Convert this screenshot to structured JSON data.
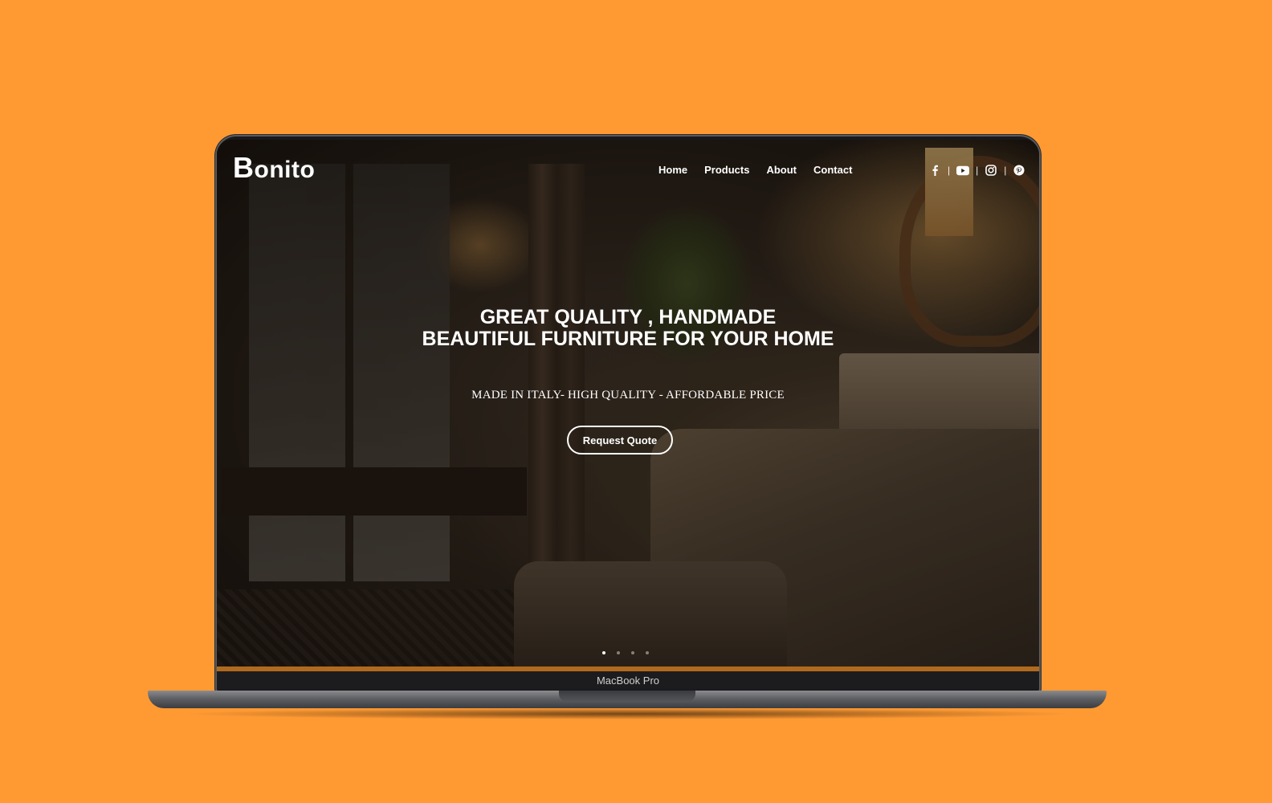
{
  "site": {
    "logo_initial": "B",
    "logo_rest": "onito"
  },
  "nav": {
    "items": [
      {
        "label": "Home"
      },
      {
        "label": "Products"
      },
      {
        "label": "About"
      },
      {
        "label": "Contact"
      }
    ]
  },
  "social": {
    "icons": [
      "facebook-icon",
      "youtube-icon",
      "instagram-icon",
      "pinterest-icon"
    ],
    "separator": "|"
  },
  "hero": {
    "title_line1": "GREAT QUALITY , HANDMADE",
    "title_line2": "BEAUTIFUL FURNITURE FOR YOUR HOME",
    "subtitle": "MADE IN ITALY- HIGH QUALITY - AFFORDABLE PRICE",
    "cta_label": "Request Quote",
    "slides_total": 4,
    "active_slide": 1
  },
  "device": {
    "label": "MacBook Pro"
  },
  "colors": {
    "background": "#ff9a33",
    "accent_bar": "#b06a1e"
  }
}
